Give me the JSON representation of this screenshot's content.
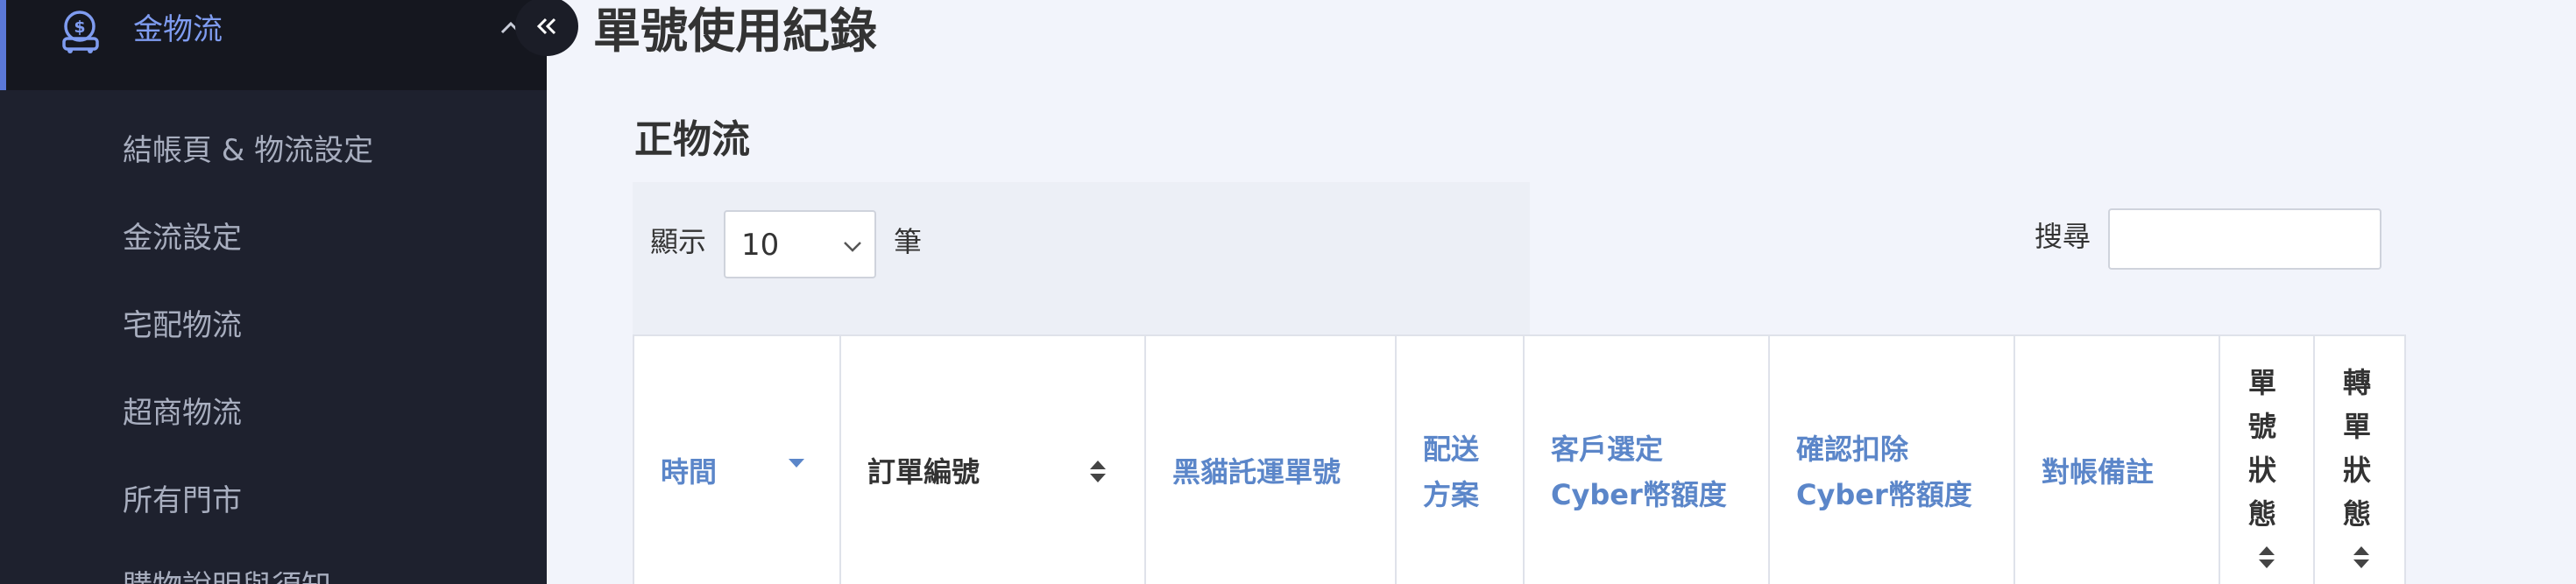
{
  "sidebar": {
    "active_item": {
      "label": "金物流",
      "icon": "money-bag-icon"
    },
    "items": [
      {
        "label": "結帳頁 & 物流設定"
      },
      {
        "label": "金流設定"
      },
      {
        "label": "宅配物流"
      },
      {
        "label": "超商物流"
      },
      {
        "label": "所有門市"
      },
      {
        "label": "購物說明與須知"
      }
    ],
    "collapse_glyph": "«"
  },
  "page": {
    "title": "單號使用紀錄"
  },
  "section": {
    "title": "正物流"
  },
  "controls": {
    "show_label": "顯示",
    "page_length": "10",
    "unit_label": "筆",
    "search_label": "搜尋",
    "search_value": ""
  },
  "table": {
    "columns": [
      {
        "lines": [
          "時間"
        ],
        "style": "blue",
        "sort": "desc"
      },
      {
        "lines": [
          "訂單編號"
        ],
        "style": "dark",
        "sort": "both"
      },
      {
        "lines": [
          "黑貓託運單號"
        ],
        "style": "blue",
        "sort": "none"
      },
      {
        "lines": [
          "配送",
          "方案"
        ],
        "style": "blue",
        "sort": "none"
      },
      {
        "lines": [
          "客戶選定",
          "Cyber幣額度"
        ],
        "style": "blue",
        "sort": "none"
      },
      {
        "lines": [
          "確認扣除",
          "Cyber幣額度"
        ],
        "style": "blue",
        "sort": "none"
      },
      {
        "lines": [
          "對帳備註"
        ],
        "style": "blue",
        "sort": "none"
      },
      {
        "lines": [
          "單",
          "號",
          "狀",
          "態"
        ],
        "style": "dark",
        "sort": "both"
      },
      {
        "lines": [
          "轉",
          "單",
          "狀",
          "態"
        ],
        "style": "dark",
        "sort": "both"
      }
    ]
  },
  "colors": {
    "accent": "#5a78d8",
    "link": "#5b86c9",
    "sidebar_bg": "#1e212e"
  }
}
